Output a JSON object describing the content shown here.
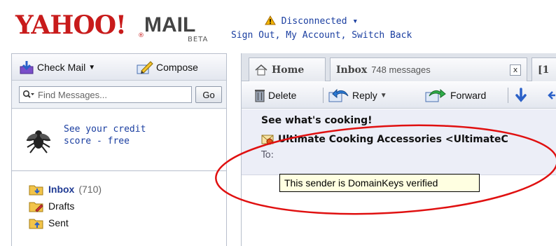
{
  "header": {
    "logo_yahoo": "YAHOO!",
    "logo_mail": "MAIL",
    "logo_beta": "BETA",
    "logo_reg": "®",
    "status": "Disconnected",
    "status_dropdown": "▾",
    "links": [
      "Sign Out",
      "My Account",
      "Switch Back"
    ],
    "link_sep": ", "
  },
  "sidebar": {
    "check_mail": "Check Mail",
    "compose": "Compose",
    "search_placeholder": "Find Messages...",
    "go": "Go",
    "ad_text": "See your credit\nscore - free",
    "folders": [
      {
        "name": "Inbox",
        "count": "(710)"
      },
      {
        "name": "Drafts"
      },
      {
        "name": "Sent"
      }
    ]
  },
  "tabs": [
    {
      "label": "Home"
    },
    {
      "label": "Inbox",
      "sub": "748 messages",
      "close": "x"
    },
    {
      "label": "[1"
    }
  ],
  "toolbar": {
    "delete": "Delete",
    "reply": "Reply",
    "forward": "Forward"
  },
  "message": {
    "subject": "See what's cooking!",
    "from": "Ultimate Cooking Accessories <UltimateC",
    "to_label": "To:"
  },
  "tooltip": "This sender is DomainKeys verified",
  "colors": {
    "yahoo_red": "#c81b1b",
    "link_blue": "#1a3ea0",
    "annotation_red": "#e01010",
    "tooltip_bg": "#ffffe1"
  }
}
